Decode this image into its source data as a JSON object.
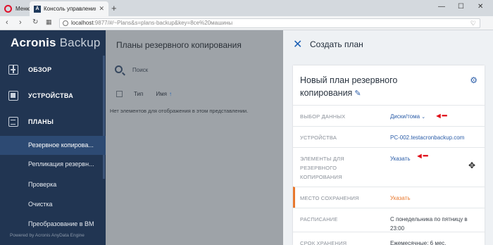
{
  "browser": {
    "tabs": [
      {
        "label": "Меню"
      },
      {
        "label": "Консоль управления резерв"
      }
    ],
    "new_tab": "+",
    "url_host": "localhost",
    "url_rest": ":9877/#/~Plans&s=plans-backup&key=8ce%20машины",
    "window": {
      "minimize": "—",
      "maximize": "☐",
      "close": "✕"
    }
  },
  "app": {
    "logo_brand": "Acronis",
    "logo_product": "Backup",
    "nav": [
      {
        "label": "ОБЗОР",
        "icon": "dashboard-icon"
      },
      {
        "label": "УСТРОЙСТВА",
        "icon": "devices-icon"
      },
      {
        "label": "ПЛАНЫ",
        "icon": "plans-icon"
      }
    ],
    "subnav": [
      {
        "label": "Резервное копирова..."
      },
      {
        "label": "Репликация резервн..."
      },
      {
        "label": "Проверка"
      },
      {
        "label": "Очистка"
      },
      {
        "label": "Преобразование в ВМ"
      }
    ],
    "powered_by": "Powered by Acronis AnyData Engine"
  },
  "list": {
    "title": "Планы резервного копирования",
    "search_placeholder": "Поиск",
    "col_type": "Тип",
    "col_name": "Имя",
    "sort_arrow": "↑",
    "empty_message": "Нет элементов для отображения в этом представлении."
  },
  "panel": {
    "close": "✕",
    "title": "Создать план",
    "card_title": "Новый план резервного копирования",
    "rows": [
      {
        "key": "ВЫБОР ДАННЫХ",
        "value": "Диски/тома"
      },
      {
        "key": "УСТРОЙСТВА",
        "value": "PC-002.testacronbackup.com"
      },
      {
        "key": "ЭЛЕМЕНТЫ ДЛЯ РЕЗЕРВНОГО КОПИРОВАНИЯ",
        "value": "Указать"
      },
      {
        "key": "МЕСТО СОХРАНЕНИЯ",
        "value": "Указать"
      },
      {
        "key": "РАСПИСАНИЕ",
        "value": "С понедельника по пятницу в 23:00"
      },
      {
        "key": "СРОК ХРАНЕНИЯ",
        "value": "Ежемесячные: 6 мес."
      }
    ]
  },
  "colors": {
    "sidebar_bg": "#213552",
    "accent_blue": "#2b5da8",
    "accent_orange": "#e8782e",
    "arrow_red": "#e0101a"
  }
}
